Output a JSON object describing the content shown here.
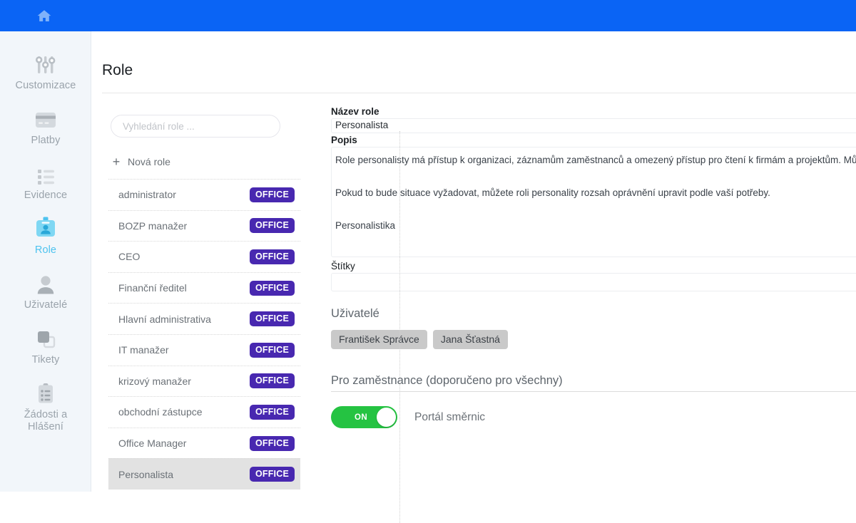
{
  "topbar": {
    "home_icon": "home-icon"
  },
  "sidebar": {
    "items": [
      {
        "label": "Customizace",
        "icon": "sliders-icon",
        "active": false
      },
      {
        "label": "Platby",
        "icon": "credit-card-icon",
        "active": false
      },
      {
        "label": "Evidence",
        "icon": "list-icon",
        "active": false
      },
      {
        "label": "Role",
        "icon": "id-badge-icon",
        "active": true
      },
      {
        "label": "Uživatelé",
        "icon": "user-icon",
        "active": false
      },
      {
        "label": "Tikety",
        "icon": "windows-icon",
        "active": false
      },
      {
        "label": "Žádosti a\nHlášení",
        "icon": "clipboard-icon",
        "active": false
      }
    ]
  },
  "header": {
    "title": "Role"
  },
  "list_panel": {
    "search_placeholder": "Vyhledání role ...",
    "search_value": "",
    "new_role_label": "Nová role",
    "plus_icon": "plus-icon",
    "rows": [
      {
        "name": "administrator",
        "badge": "OFFICE",
        "selected": false
      },
      {
        "name": "BOZP manažer",
        "badge": "OFFICE",
        "selected": false
      },
      {
        "name": "CEO",
        "badge": "OFFICE",
        "selected": false
      },
      {
        "name": "Finanční ředitel",
        "badge": "OFFICE",
        "selected": false
      },
      {
        "name": "Hlavní administrativa",
        "badge": "OFFICE",
        "selected": false
      },
      {
        "name": "IT manažer",
        "badge": "OFFICE",
        "selected": false
      },
      {
        "name": "krizový manažer",
        "badge": "OFFICE",
        "selected": false
      },
      {
        "name": "obchodní zástupce",
        "badge": "OFFICE",
        "selected": false
      },
      {
        "name": "Office Manager",
        "badge": "OFFICE",
        "selected": false
      },
      {
        "name": "Personalista",
        "badge": "OFFICE",
        "selected": true
      }
    ]
  },
  "detail": {
    "name_label": "Název role",
    "name_value": "Personalista",
    "description_label": "Popis",
    "description_value": "Role personalisty má přístup k organizaci, záznamům zaměstnanců a omezený přístup pro čtení k firmám a projektům. Může\n\nPokud to bude situace vyžadovat, můžete roli personality rozsah oprávnění upravit podle vaší potřeby.\n\nPersonalistika",
    "tags_label": "Štítky",
    "tags_value": "",
    "users_label": "Uživatelé",
    "users": [
      "František Správce",
      "Jana Šťastná"
    ],
    "employees_section_label": "Pro zaměstnance (doporučeno pro všechny)",
    "toggles": [
      {
        "state": "ON",
        "label": "Portál směrnic",
        "on": true
      }
    ]
  },
  "colors": {
    "topbar": "#0a64f5",
    "sidebar_bg": "#f2f6fa",
    "accent_active": "#4ec3ef",
    "badge": "#4828b0",
    "toggle_on": "#25c342",
    "chip": "#c9c9c9"
  }
}
